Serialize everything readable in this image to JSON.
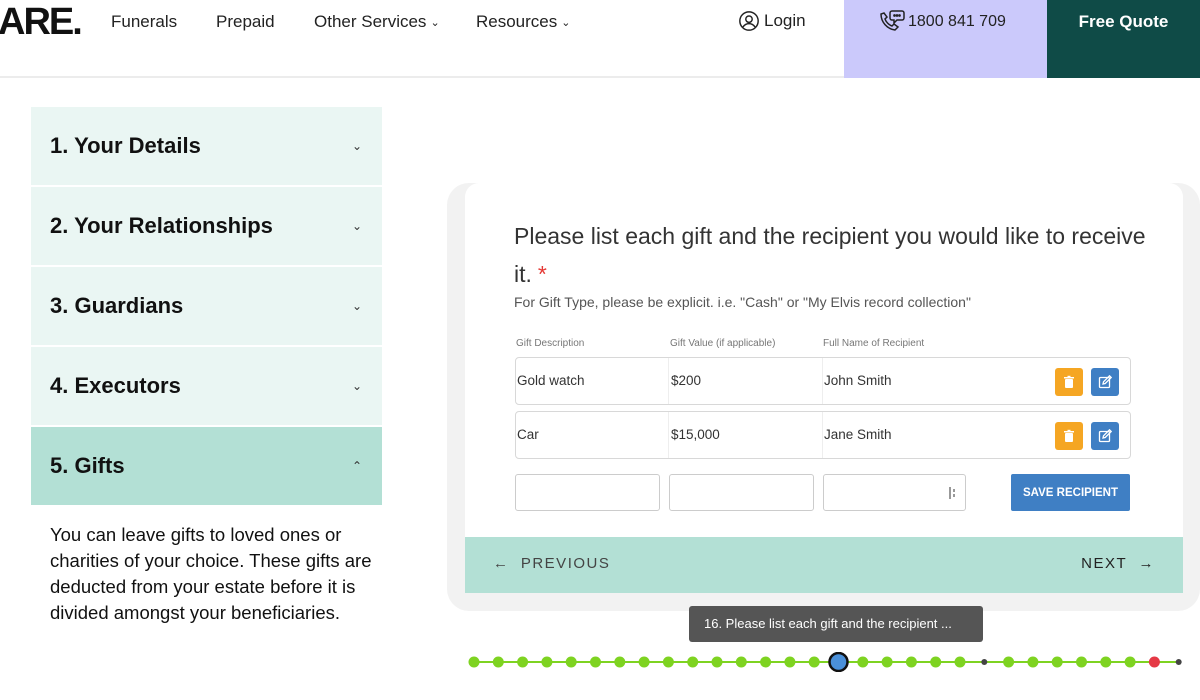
{
  "header": {
    "logo": "ARE.",
    "nav": [
      {
        "label": "Funerals",
        "has_dropdown": false
      },
      {
        "label": "Prepaid",
        "has_dropdown": false
      },
      {
        "label": "Other Services",
        "has_dropdown": true
      },
      {
        "label": "Resources",
        "has_dropdown": true
      }
    ],
    "login_label": "Login",
    "phone": "1800 841 709",
    "quote_label": "Free Quote",
    "colors": {
      "phone_bg": "#cbc9fb",
      "quote_bg": "#0f4b47"
    }
  },
  "steps": [
    {
      "label": "1. Your Details",
      "active": false
    },
    {
      "label": "2. Your Relationships",
      "active": false
    },
    {
      "label": "3. Guardians",
      "active": false
    },
    {
      "label": "4. Executors",
      "active": false
    },
    {
      "label": "5. Gifts",
      "active": true
    }
  ],
  "step_description": "You can leave gifts to loved ones or charities of your choice. These gifts are deducted from your estate before it is divided amongst your beneficiaries.",
  "question": {
    "title": "Please list each gift and the recipient you would like to receive it.",
    "required_mark": "*",
    "help": "For Gift Type, please be explicit. i.e. \"Cash\" or \"My Elvis record collection\"",
    "columns": [
      "Gift Description",
      "Gift Value (if applicable)",
      "Full Name of Recipient"
    ],
    "rows": [
      {
        "description": "Gold watch",
        "value": "$200",
        "recipient": "John Smith"
      },
      {
        "description": "Car",
        "value": "$15,000",
        "recipient": "Jane Smith"
      }
    ],
    "save_label": "SAVE RECIPIENT"
  },
  "navigation": {
    "previous_label": "PREVIOUS",
    "next_label": "NEXT"
  },
  "tooltip": "16. Please list each gift and the recipient ...",
  "progress": {
    "states": [
      "done",
      "done",
      "done",
      "done",
      "done",
      "done",
      "done",
      "done",
      "done",
      "done",
      "done",
      "done",
      "done",
      "done",
      "done",
      "current",
      "done",
      "done",
      "done",
      "done",
      "done",
      "pending",
      "done",
      "done",
      "done",
      "done",
      "done",
      "done",
      "error",
      "pending"
    ],
    "colors": {
      "done": "#7ed321",
      "current": "#4a90d9",
      "pending": "#444444",
      "error": "#e53945"
    }
  }
}
